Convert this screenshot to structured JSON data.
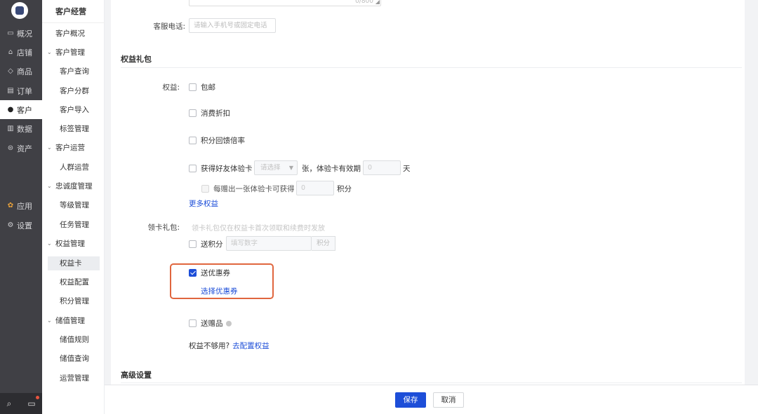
{
  "rail": {
    "items": [
      {
        "icon": "monitor-icon",
        "glyph": "▭",
        "label": "概况"
      },
      {
        "icon": "store-icon",
        "glyph": "⌂",
        "label": "店铺"
      },
      {
        "icon": "tag-icon",
        "glyph": "◇",
        "label": "商品"
      },
      {
        "icon": "list-icon",
        "glyph": "▤",
        "label": "订单"
      },
      {
        "icon": "user-icon",
        "glyph": "●",
        "label": "客户"
      },
      {
        "icon": "bar-chart-icon",
        "glyph": "▥",
        "label": "数据"
      },
      {
        "icon": "coin-icon",
        "glyph": "⊜",
        "label": "资产"
      },
      {
        "icon": "apps-icon",
        "glyph": "✿",
        "label": "应用"
      },
      {
        "icon": "gear-icon",
        "glyph": "⚙",
        "label": "设置"
      }
    ],
    "search_glyph": "⌕",
    "message_glyph": "▭"
  },
  "sidebar": {
    "title": "客户经营",
    "items": [
      "客户概况",
      "客户管理",
      "客户查询",
      "客户分群",
      "客户导入",
      "标签管理",
      "客户运营",
      "人群运营",
      "忠诚度管理",
      "等级管理",
      "任务管理",
      "权益管理",
      "权益卡",
      "权益配置",
      "积分管理",
      "储值管理",
      "储值规则",
      "储值查询",
      "运营管理"
    ]
  },
  "form": {
    "textarea_count": "0/800",
    "service_phone_label": "客服电话:",
    "service_phone_placeholder": "请输入手机号或固定电话",
    "section_benefits": "权益礼包",
    "benefits_label": "权益:",
    "free_shipping": "包邮",
    "discount": "消费折扣",
    "points_rate": "积分回馈倍率",
    "friend_card_prefix": "获得好友体验卡",
    "friend_card_select": "请选择",
    "friend_card_mid": "张，体验卡有效期",
    "friend_card_days_value": "0",
    "friend_card_days_unit": "天",
    "per_card_label": "每赠出一张体验卡可获得",
    "per_card_value": "0",
    "per_card_unit": "积分",
    "more_benefits": "更多权益",
    "gift_label": "领卡礼包:",
    "gift_hint": "领卡礼包仅在权益卡首次领取和续费时发放",
    "send_points": "送积分",
    "send_points_placeholder": "填写数字",
    "send_points_unit": "积分",
    "send_coupon": "送优惠券",
    "select_coupon": "选择优惠券",
    "send_gift": "送赠品",
    "not_enough": "权益不够用?",
    "configure_benefits": "去配置权益",
    "section_advanced": "高级设置"
  },
  "footer": {
    "save": "保存",
    "cancel": "取消"
  },
  "colors": {
    "primary": "#1d4ed8",
    "highlight": "#e0663e"
  }
}
